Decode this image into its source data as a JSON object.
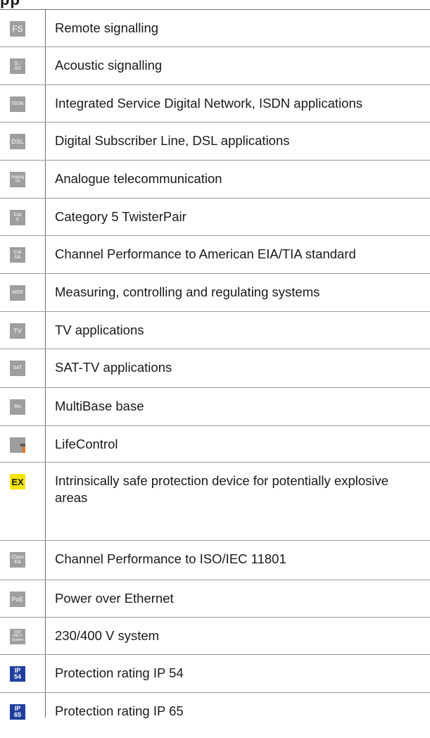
{
  "heading_fragment": "pp",
  "rows": [
    {
      "icon_name": "fs-icon",
      "icon_text": "FS",
      "label": "Remote signalling"
    },
    {
      "icon_name": "acoustic-signal-icon",
      "icon_text": "((□\nAS",
      "label": "Acoustic signalling"
    },
    {
      "icon_name": "isdn-icon",
      "icon_text": "ISDN",
      "label": "Integrated Service Digital Network, ISDN applications"
    },
    {
      "icon_name": "dsl-icon",
      "icon_text": "DSL",
      "label": "Digital Subscriber Line, DSL applications"
    },
    {
      "icon_name": "analog-tk-icon",
      "icon_text": "Analog\nTK",
      "label": "Analogue telecommunication"
    },
    {
      "icon_name": "cat5-icon",
      "icon_text": "Cat\n5",
      "label": "Category 5 TwisterPair"
    },
    {
      "icon_name": "cat6a-icon",
      "icon_text": "Cat\n6A",
      "label": "Channel Performance to American EIA/TIA standard"
    },
    {
      "icon_name": "msr-icon",
      "icon_text": "MSR",
      "label": "Measuring, controlling and regulating systems"
    },
    {
      "icon_name": "tv-icon",
      "icon_text": "TV",
      "label": "TV applications"
    },
    {
      "icon_name": "sat-icon",
      "icon_text": "SAT",
      "label": "SAT-TV applications"
    },
    {
      "icon_name": "mu-icon",
      "icon_text": "Mu",
      "label": "MultiBase base"
    },
    {
      "icon_name": "lifecontrol-icon",
      "icon_text": "Life Control",
      "label": "LifeControl"
    },
    {
      "icon_name": "ex-icon",
      "icon_text": "EX",
      "label": "Intrinsically safe protection device for potentially explosive areas"
    },
    {
      "icon_name": "class-ea-icon",
      "icon_text": "Class\nEA",
      "label": "Channel Performance to ISO/IEC 11801"
    },
    {
      "icon_name": "poe-icon",
      "icon_text": "PoE",
      "label": "Power over Ethernet"
    },
    {
      "icon_name": "230-400v-system-icon",
      "icon_text": "230/\n400 V\nSystem",
      "label": "230/400 V system"
    },
    {
      "icon_name": "ip54-icon",
      "icon_text": "IP\n54",
      "label": "Protection rating IP 54"
    },
    {
      "icon_name": "ip65-icon",
      "icon_text": "IP\n65",
      "label": "Protection rating IP 65"
    }
  ],
  "colors": {
    "icon_grey": "#9e9e9e",
    "ex_yellow": "#f4e400",
    "ip_blue": "#1f3f9e",
    "lifecontrol_orange": "#e8761c"
  }
}
